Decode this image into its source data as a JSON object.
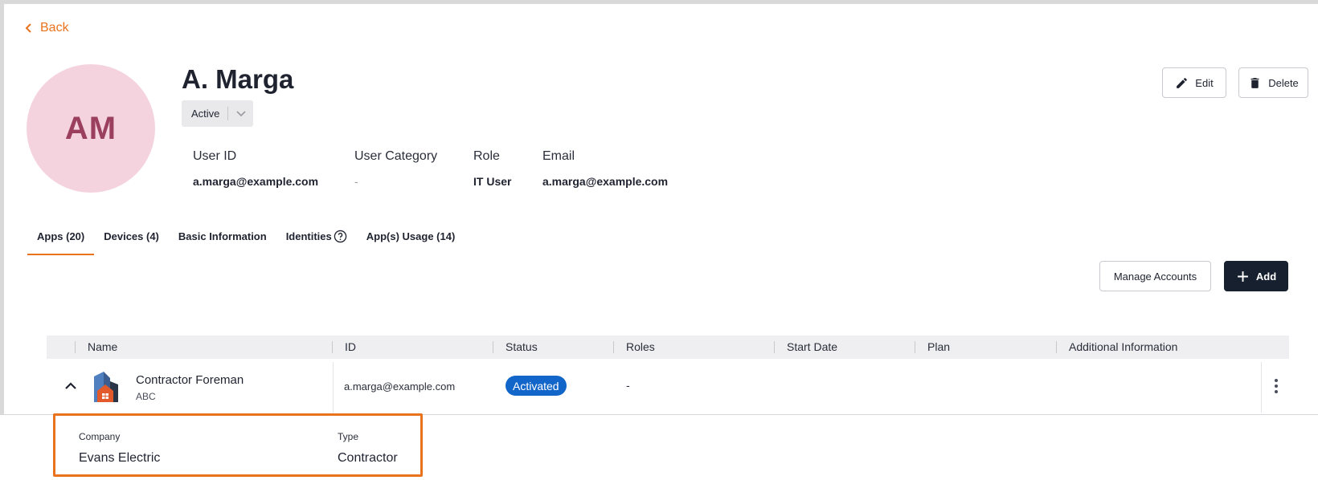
{
  "nav": {
    "back_label": "Back"
  },
  "user": {
    "initials": "AM",
    "name": "A. Marga",
    "status": "Active",
    "fields": [
      {
        "label": "User ID",
        "value": "a.marga@example.com"
      },
      {
        "label": "User Category",
        "value": "-"
      },
      {
        "label": "Role",
        "value": "IT User"
      },
      {
        "label": "Email",
        "value": "a.marga@example.com"
      }
    ]
  },
  "actions": {
    "edit_label": "Edit",
    "delete_label": "Delete"
  },
  "tabs": [
    {
      "label": "Apps (20)",
      "active": true
    },
    {
      "label": "Devices (4)"
    },
    {
      "label": "Basic Information"
    },
    {
      "label": "Identities"
    },
    {
      "label": "App(s) Usage (14)"
    }
  ],
  "toolbar": {
    "manage_label": "Manage Accounts",
    "add_label": "Add"
  },
  "table": {
    "columns": [
      "Name",
      "ID",
      "Status",
      "Roles",
      "Start Date",
      "Plan",
      "Additional Information"
    ],
    "rows": [
      {
        "app_name": "Contractor Foreman",
        "app_sub": "ABC",
        "id": "a.marga@example.com",
        "status": "Activated",
        "roles": "-",
        "start_date": "",
        "plan": "",
        "additional": "",
        "details": {
          "company_label": "Company",
          "company_value": "Evans Electric",
          "type_label": "Type",
          "type_value": "Contractor"
        }
      }
    ]
  },
  "colors": {
    "accent": "#e8731c",
    "primary_dark": "#17202e",
    "status_active": "#1366c9",
    "avatar_bg": "#f4d3de",
    "avatar_text": "#9a3f5e"
  },
  "icons": [
    "chevron-left-icon",
    "chevron-down-icon",
    "pencil-icon",
    "trash-icon",
    "help-circle-icon",
    "plus-icon",
    "chevron-up-icon",
    "app-logo-icon",
    "kebab-icon"
  ]
}
